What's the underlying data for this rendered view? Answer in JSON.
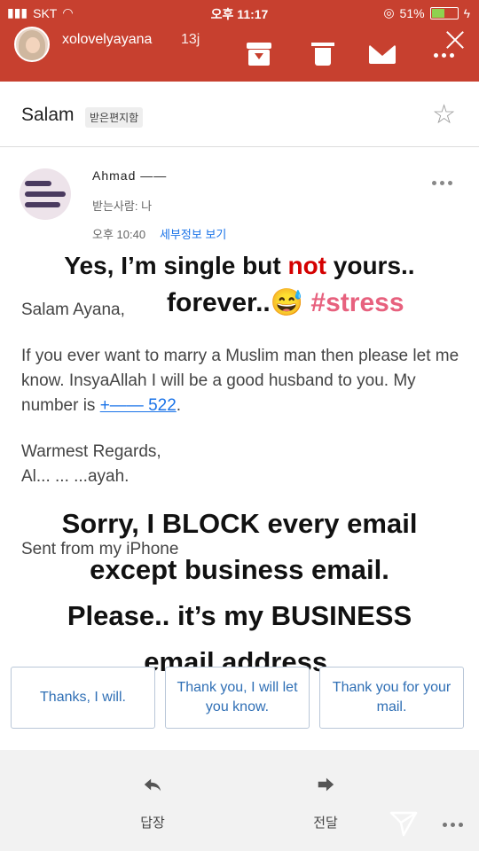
{
  "status": {
    "carrier": "SKT",
    "time": "오후 11:17",
    "battery": "51%",
    "battery_level": 0.51
  },
  "story": {
    "username": "xolovelyayana",
    "time_ago": "13j"
  },
  "email": {
    "subject": "Salam",
    "badge": "받은편지함",
    "sender": "Ahmad ——",
    "recipient": "받는사람: 나",
    "time": "오후 10:40",
    "details_link": "세부정보 보기",
    "greeting": "Salam Ayana,",
    "message": "If you ever want to marry a Muslim man then please let me know. InsyaAllah I will be a good husband to you. My number is ",
    "phone": "+——    522",
    "message_end": ".",
    "regards": "Warmest Regards,",
    "signature": "Al... ... ...ayah.",
    "sent_from": "Sent from my iPhone"
  },
  "overlay": {
    "line1_a": "Yes, I’m single but ",
    "line1_red": "not",
    "line1_b": " yours..",
    "line2_a": "forever..😅 ",
    "line2_tag": "#stress",
    "line3": "Sorry, I BLOCK every email",
    "line4": "except business email.",
    "line5": "Please.. it’s my BUSINESS",
    "line6": "email address."
  },
  "quick_replies": [
    "Thanks, I will.",
    "Thank you, I will let you know.",
    "Thank you for your mail."
  ],
  "actions": {
    "reply": "답장",
    "forward": "전달"
  },
  "colors": {
    "story_bar": "#c7402f",
    "link": "#1a73e8",
    "accent_red": "#d40000",
    "hashtag": "#e7617e"
  }
}
